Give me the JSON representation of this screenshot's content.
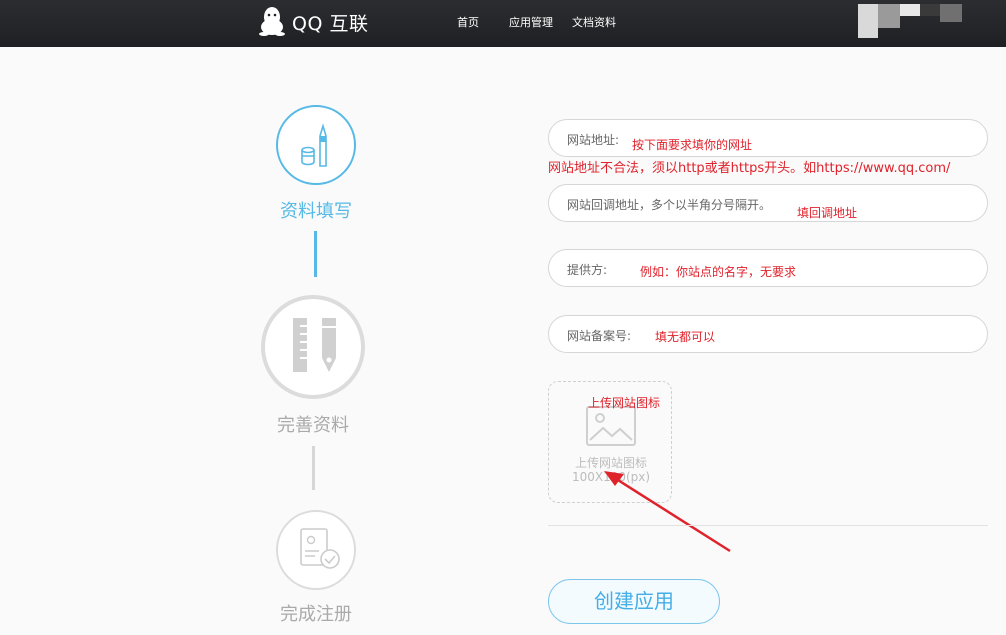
{
  "header": {
    "logo_text": "QQ 互联",
    "nav": [
      "首页",
      "应用管理",
      "文档资料"
    ]
  },
  "steps": [
    {
      "label": "资料填写",
      "state": "active"
    },
    {
      "label": "完善资料",
      "state": "inactive"
    },
    {
      "label": "完成注册",
      "state": "inactive"
    }
  ],
  "form": {
    "website_url": {
      "placeholder": "网站地址:"
    },
    "callback_url": {
      "placeholder": "网站回调地址，多个以半角分号隔开。"
    },
    "provider": {
      "placeholder": "提供方:"
    },
    "icp": {
      "placeholder": "网站备案号:"
    },
    "upload": {
      "line1": "上传网站图标",
      "line2": "100X100(px)"
    },
    "create_button": "创建应用"
  },
  "annotations": {
    "website_hint": "按下面要求填你的网址",
    "website_error": "网站地址不合法，须以http或者https开头。如https://www.qq.com/",
    "callback_hint": "填回调地址",
    "provider_hint": "例如：你站点的名字，无要求",
    "icp_hint": "填无都可以",
    "upload_hint": "上传网站图标"
  },
  "colors": {
    "active": "#56b9e6",
    "inactive": "#d0d0d0",
    "annotation": "#e0222b",
    "header": "#232428"
  }
}
